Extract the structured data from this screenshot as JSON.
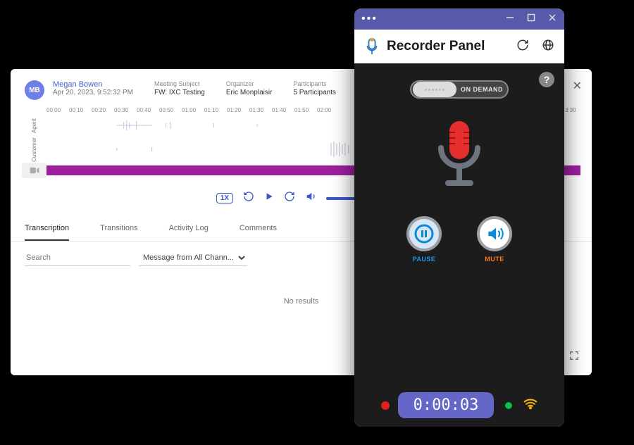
{
  "transcript": {
    "avatarInitials": "MB",
    "ownerName": "Megan Bowen",
    "timestamp": "Apr 20, 2023, 9:52:32 PM",
    "meta": {
      "subjectLabel": "Meeting Subject",
      "subject": "FW: IXC Testing",
      "organizerLabel": "Organizer",
      "organizer": "Eric Monplaisir",
      "participantsLabel": "Participants",
      "participants": "5 Participants"
    },
    "tracks": {
      "agentLabel": "Agent",
      "customerLabel": "Customer"
    },
    "timelineTicks": [
      "00:00",
      "00:10",
      "00:20",
      "00:30",
      "00:40",
      "00:50",
      "01:00",
      "01:10",
      "01:20",
      "01:30",
      "01:40",
      "01:50",
      "02:00",
      "",
      "",
      "",
      "",
      "",
      "",
      "",
      "",
      "",
      "",
      "3:30"
    ],
    "playback": {
      "speed": "1X"
    },
    "tabs": {
      "transcription": "Transcription",
      "transitions": "Transitions",
      "activity": "Activity Log",
      "comments": "Comments"
    },
    "filters": {
      "searchPlaceholder": "Search",
      "channelFilter": "Message from All Chann..."
    },
    "noResults": "No results"
  },
  "recorder": {
    "title": "Recorder Panel",
    "toggle": {
      "right": "ON DEMAND"
    },
    "controls": {
      "pause": "PAUSE",
      "mute": "MUTE"
    },
    "elapsed": "0:00:03",
    "helpGlyph": "?"
  }
}
